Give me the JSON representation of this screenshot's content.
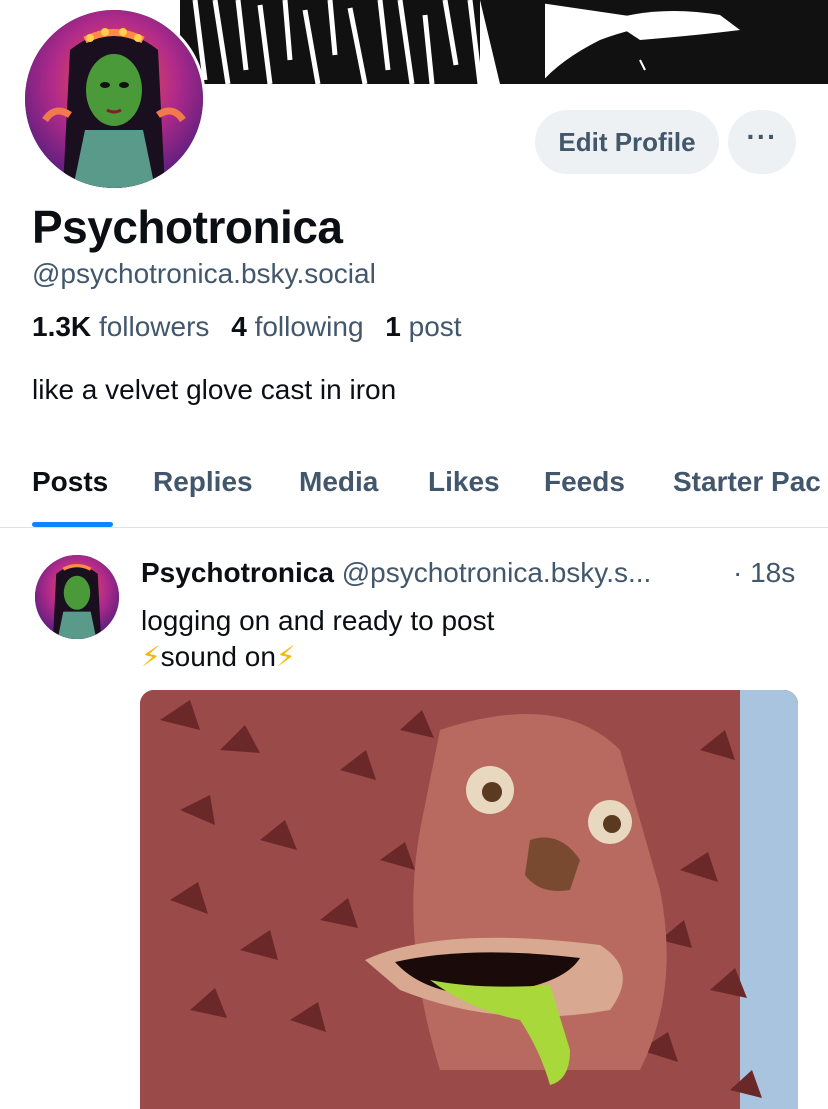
{
  "profile": {
    "display_name": "Psychotronica",
    "handle": "@psychotronica.bsky.social",
    "bio": "like a velvet glove cast in iron",
    "followers_count": "1.3K",
    "followers_label": "followers",
    "following_count": "4",
    "following_label": "following",
    "posts_count": "1",
    "posts_label": "post"
  },
  "actions": {
    "edit_label": "Edit Profile",
    "more_label": "···"
  },
  "tabs": [
    {
      "label": "Posts",
      "active": true
    },
    {
      "label": "Replies",
      "active": false
    },
    {
      "label": "Media",
      "active": false
    },
    {
      "label": "Likes",
      "active": false
    },
    {
      "label": "Feeds",
      "active": false
    },
    {
      "label": "Starter Pac",
      "active": false
    }
  ],
  "post": {
    "author": "Psychotronica",
    "handle": "@psychotronica.bsky.s...",
    "time": "· 18s",
    "line1": "logging on and ready to post",
    "bolt": "⚡",
    "line2_text": "sound on"
  },
  "colors": {
    "accent": "#1083fe",
    "muted_text": "#42576c",
    "button_bg": "#eef1f4",
    "text": "#0b0f14"
  },
  "icons": [
    "more-icon",
    "lightning-icon"
  ]
}
